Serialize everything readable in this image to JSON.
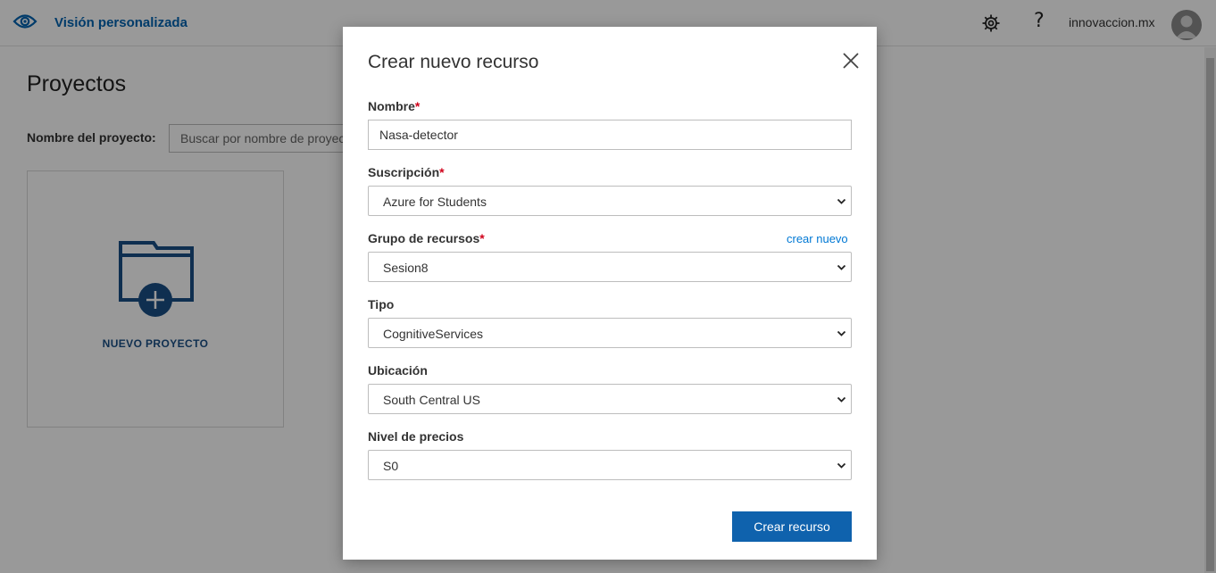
{
  "header": {
    "app_title": "Visión personalizada",
    "account_name": "innovaccion.mx",
    "help_glyph": "?",
    "icons": {
      "logo": "eye-icon",
      "settings": "gear-icon",
      "help": "help-icon",
      "user": "avatar"
    }
  },
  "page": {
    "heading": "Proyectos",
    "search_label": "Nombre del proyecto:",
    "search_placeholder": "Buscar por nombre de proyecto",
    "new_project_label": "NUEVO PROYECTO"
  },
  "modal": {
    "title": "Crear nuevo recurso",
    "fields": {
      "name": {
        "label": "Nombre",
        "value": "Nasa-detector",
        "required": true
      },
      "subscription": {
        "label": "Suscripción",
        "value": "Azure for Students",
        "required": true
      },
      "resource_group": {
        "label": "Grupo de recursos",
        "value": "Sesion8",
        "required": true,
        "link": "crear nuevo"
      },
      "type": {
        "label": "Tipo",
        "value": "CognitiveServices"
      },
      "location": {
        "label": "Ubicación",
        "value": "South Central US"
      },
      "pricing_tier": {
        "label": "Nivel de precios",
        "value": "S0"
      }
    },
    "required_marker": "*",
    "submit_label": "Crear recurso"
  },
  "colors": {
    "brand": "#0063b1",
    "primary_button": "#0f62ad",
    "link": "#0078d4",
    "required": "#d0021b",
    "overlay": "rgba(0,0,0,0.4)"
  }
}
